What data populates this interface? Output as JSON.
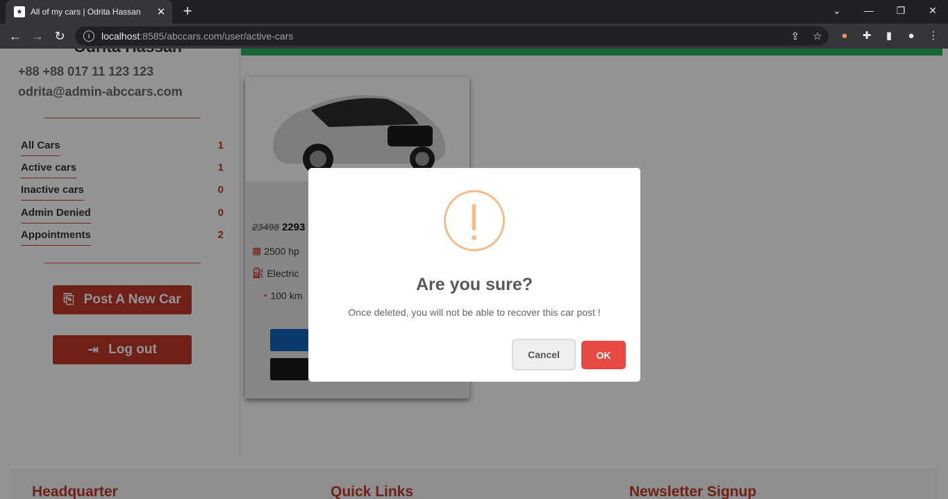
{
  "browser": {
    "tab_title": "All of my cars | Odrita Hassan",
    "url_host": "localhost",
    "url_rest": ":8585/abccars.com/user/active-cars"
  },
  "profile": {
    "name": "Odrita Hassan",
    "phone": "+88 +88 017 11 123 123",
    "email": "odrita@admin-abccars.com"
  },
  "stats": [
    {
      "label": "All Cars",
      "count": "1"
    },
    {
      "label": "Active cars",
      "count": "1"
    },
    {
      "label": "Inactive cars",
      "count": "0"
    },
    {
      "label": "Admin Denied",
      "count": "0"
    },
    {
      "label": "Appointments",
      "count": "2"
    }
  ],
  "actions": {
    "post_car": "Post A New Car",
    "logout": "Log out"
  },
  "car_card": {
    "old_price": "23498",
    "new_price": "2293",
    "power": "2500 hp",
    "fuel": "Electric",
    "mileage": "100 km"
  },
  "footer": {
    "col1": "Headquarter",
    "col2": "Quick Links",
    "col3": "Newsletter Signup"
  },
  "modal": {
    "title": "Are you sure?",
    "text": "Once deleted, you will not be able to recover this car post !",
    "cancel": "Cancel",
    "ok": "OK"
  },
  "colors": {
    "brand_red": "#c0392b",
    "warning": "#f8bb86",
    "ok_button": "#e64942"
  }
}
